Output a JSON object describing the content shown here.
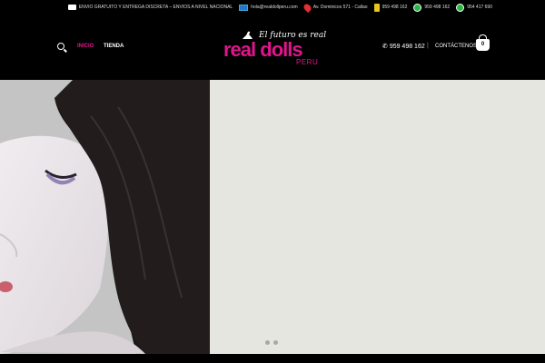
{
  "topbar": {
    "shipping_text": "ENVIO GRATUITO Y ENTREGA DISCRETA – ENVIOS A NIVEL NACIONAL",
    "email": "hola@realdollperu.com",
    "address": "Av. Dominicos 571 - Callao",
    "phone": "959 498 162",
    "whatsapp_1": "959 498 162",
    "whatsapp_2": "954 417 690"
  },
  "nav": {
    "inicio": "INICIO",
    "tienda": "TIENDA"
  },
  "logo": {
    "tagline": "El futuro es real",
    "main": "real dolls",
    "sub": "PERU"
  },
  "header_right": {
    "phone": "959 498 162",
    "separator": "|",
    "contact": "CONTÁCTENOS",
    "cart_count": "0"
  },
  "colors": {
    "brand": "#e0158c",
    "background": "#000000",
    "hero_bg": "#e6e6e1"
  },
  "hero": {
    "slides": 2,
    "active_slide": 1
  }
}
